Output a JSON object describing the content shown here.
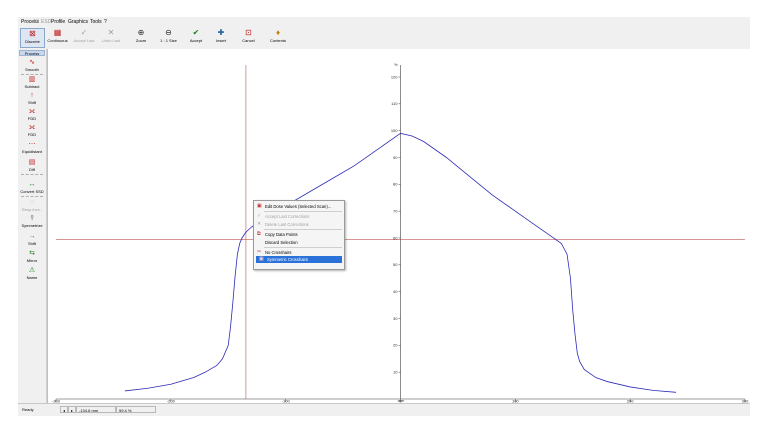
{
  "menu": [
    {
      "label": "Process",
      "enabled": true
    },
    {
      "label": "All",
      "enabled": false
    },
    {
      "label": "ESD",
      "enabled": false
    },
    {
      "label": "Profile",
      "enabled": true
    },
    {
      "label": "Graphics",
      "enabled": true
    },
    {
      "label": "Tools",
      "enabled": true
    },
    {
      "label": "?",
      "enabled": true
    }
  ],
  "toolbar": [
    {
      "label": "Discrete",
      "icon": "discrete-icon",
      "glyph": "⊠",
      "enabled": true,
      "pressed": true
    },
    {
      "label": "Continuous",
      "icon": "continuous-icon",
      "glyph": "▦",
      "enabled": true
    },
    {
      "label": "Accept Last",
      "icon": "accept-last-icon",
      "glyph": "✓",
      "enabled": false
    },
    {
      "label": "Undo Last",
      "icon": "undo-last-icon",
      "glyph": "✕",
      "enabled": false
    },
    {
      "label": "Zoom",
      "icon": "zoom-icon",
      "glyph": "⊕",
      "enabled": true
    },
    {
      "label": "1 : 1 Size",
      "icon": "actual-size-icon",
      "glyph": "⊖",
      "enabled": true
    },
    {
      "label": "Accept",
      "icon": "accept-icon",
      "glyph": "✔",
      "enabled": true
    },
    {
      "label": "Insert",
      "icon": "insert-icon",
      "glyph": "✚",
      "enabled": true
    },
    {
      "label": "Cancel",
      "icon": "cancel-icon",
      "glyph": "⊡",
      "enabled": true
    },
    {
      "label": "Contents",
      "icon": "contents-icon",
      "glyph": "♦",
      "enabled": true
    }
  ],
  "sidebar": {
    "header": "Process",
    "items": [
      {
        "label": "Smooth",
        "icon": "smooth-icon",
        "glyph": "∿",
        "enabled": true
      },
      {
        "label": "Subtract",
        "icon": "subtract-icon",
        "glyph": "▥",
        "enabled": true
      },
      {
        "label": "Shift",
        "icon": "shift-up-icon",
        "glyph": "↑",
        "enabled": true
      },
      {
        "label": "FDD",
        "icon": "fdd-icon",
        "glyph": "⟗",
        "enabled": true
      },
      {
        "label": "FDD",
        "icon": "fdd-icon",
        "glyph": "⟗",
        "enabled": true
      },
      {
        "label": "Equidistant",
        "icon": "equidistant-icon",
        "glyph": "⋯",
        "enabled": true
      },
      {
        "label": "Diff",
        "icon": "diff-icon",
        "glyph": "▤",
        "enabled": true
      },
      {
        "label": "Convert SSD",
        "icon": "convert-ssd-icon",
        "glyph": "↔",
        "enabled": true
      },
      {
        "label": "Resp.Inve..",
        "icon": "response-icon",
        "glyph": "◌",
        "enabled": false
      },
      {
        "label": "Symmetrize",
        "icon": "symmetrize-icon",
        "glyph": "⫯",
        "enabled": true
      },
      {
        "label": "Shift",
        "icon": "shift-right-icon",
        "glyph": "→",
        "enabled": true
      },
      {
        "label": "Mirror",
        "icon": "mirror-icon",
        "glyph": "⇆",
        "enabled": true
      },
      {
        "label": "Name",
        "icon": "name-icon",
        "glyph": "⚠",
        "enabled": true
      }
    ]
  },
  "context_menu": [
    {
      "label": "Edit Dose Values (Selected Scan)...",
      "icon": "edit-dose-icon",
      "glyph": "▣",
      "enabled": true
    },
    {
      "sep": true
    },
    {
      "label": "Accept Last Corrections",
      "icon": "accept-last-icon",
      "glyph": "✓",
      "enabled": false
    },
    {
      "label": "Delete Last Corrections",
      "icon": "delete-last-icon",
      "glyph": "✕",
      "enabled": false
    },
    {
      "sep": true
    },
    {
      "label": "Copy Data Points",
      "icon": "copy-icon",
      "glyph": "⧉",
      "enabled": true
    },
    {
      "label": "Discard Selection",
      "icon": "",
      "glyph": "",
      "enabled": true
    },
    {
      "sep": true
    },
    {
      "label": "No Crosshairs",
      "icon": "no-crosshairs-icon",
      "glyph": "✂",
      "enabled": true
    },
    {
      "label": "Symmetric Crosshairs",
      "icon": "symmetric-crosshairs-icon",
      "glyph": "▣",
      "enabled": true,
      "selected": true
    }
  ],
  "status": [
    {
      "label": "Ready"
    },
    {
      "label": "◂"
    },
    {
      "label": "▸"
    },
    {
      "label": "-134.6 mm"
    },
    {
      "label": "59.4 %"
    }
  ],
  "chart_data": {
    "type": "line",
    "x_unit": "mm",
    "y_unit": "%",
    "xlim": [
      -300,
      300
    ],
    "ylim": [
      0,
      120
    ],
    "x_ticks": [
      -300,
      -200,
      -100,
      0,
      100,
      200,
      300
    ],
    "y_ticks": [
      0,
      10,
      20,
      30,
      40,
      50,
      60,
      70,
      80,
      90,
      100,
      110,
      120
    ],
    "crosshair": {
      "x": -134.6,
      "y": 59.4
    },
    "line_color": "#2b2bb8",
    "crosshair_color": "#b03030",
    "series": [
      {
        "x": [
          -240,
          -220,
          -200,
          -180,
          -170,
          -160,
          -155,
          -150,
          -148,
          -146,
          -144,
          -142,
          -140,
          -138,
          -135,
          -130,
          -120,
          -110,
          -100,
          -80,
          -60,
          -40,
          -20,
          0,
          10,
          20,
          40,
          60,
          80,
          100,
          120,
          130,
          140,
          145,
          148,
          150,
          152,
          154,
          156,
          160,
          170,
          180,
          200,
          220,
          240
        ],
        "y": [
          3,
          4,
          5.5,
          8,
          10,
          12.5,
          15,
          20,
          27,
          36,
          46,
          54,
          58,
          60,
          62,
          64,
          67,
          70,
          72,
          77,
          82,
          87,
          93,
          99,
          98,
          96,
          90,
          83,
          76,
          70,
          64,
          61,
          58,
          54,
          45,
          33,
          24,
          17,
          14,
          11,
          8,
          6.5,
          4.5,
          3.2,
          2.5
        ]
      }
    ]
  }
}
